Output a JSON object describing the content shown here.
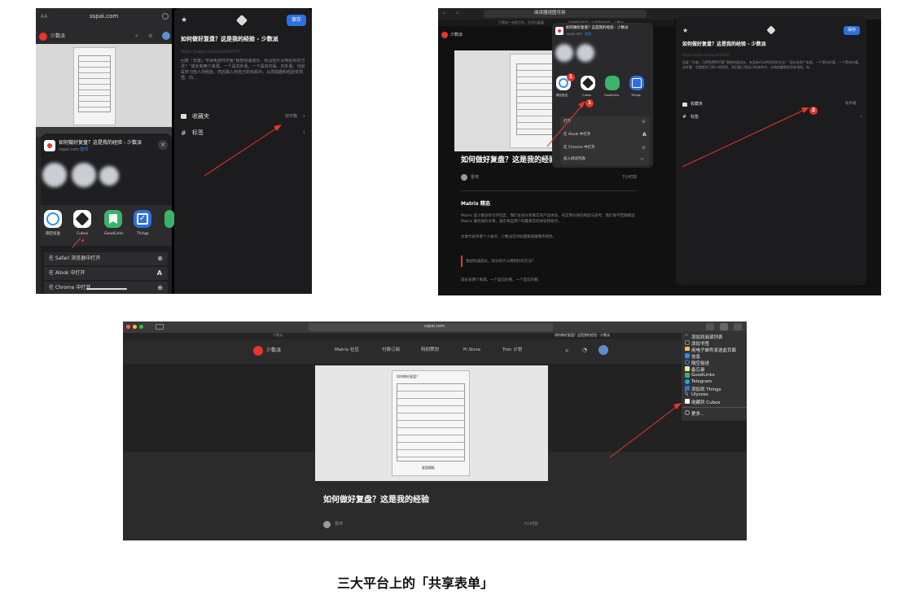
{
  "panel1": {
    "url_size": "AA",
    "url": "sspai.com",
    "site_name": "少数派",
    "share_title": "如何做好复盘？这是我的经验 - 少数派",
    "share_domain": "sspai.com",
    "share_options": "选项",
    "apps": [
      "隔空投送",
      "Cubox",
      "GoodLinks",
      "Things"
    ],
    "actions": [
      "在 Safari 浏览器中打开",
      "在 Alook 中打开",
      "在 Chrome 中打开"
    ],
    "sheet": {
      "save": "保存",
      "title": "如何做好复盘？这是我的经验 - 少数派",
      "url": "https://sspai.com/post/61557",
      "desc": "回复「年度」可得免费PDF版“我想快速成长，有没有什么特别好的方法？”成长有两个来源，一个是向外看，一个是向内看。向外看：也就是学习他人的经验，然后融入到自己的体系中。从周底趣和经验有领悟。向...",
      "folder": "收藏夹",
      "folder_value": "收件箱",
      "tags": "标签"
    }
  },
  "panel2": {
    "address": "阅读器视图可用",
    "tab_left": "只是说一句话工作、生活与复盘",
    "tab_right": "如何做好复盘？这是我的经验 - 少数派",
    "url": "sspai.com",
    "site_name": "少数派",
    "share_title": "如何做好复盘？这是我的经验 - 少数派",
    "share_domain": "sspai.com",
    "share_options": "选项",
    "apps": [
      "隔空投送",
      "Cubox",
      "GoodLinks",
      "Things"
    ],
    "app_badge": "1",
    "actions": [
      "打开",
      "在 Alook 中打开",
      "在 Chrome 中打开",
      "加入阅读列表"
    ],
    "article_title": "如何做好复盘？这是我的经验",
    "author": "曹琦",
    "time": "7小时前",
    "section": "Matrix 精选",
    "body1": "Matrix 是少数派的写作社区，我们主张分享真实的产品体验、有实用价值的经验与思考。我们会不定期挑选 Matrix 最优质的文章，展示来自用户的最真实的体验和观点。",
    "body2": "文章代表作者个人观点，少数派仅对标题和排版略作修改。",
    "quote": "我想快速成长，有没有什么特别好的方法？",
    "body3": "成长有两个来源，一个是向外看，一个是向内看：",
    "sheet": {
      "save": "保存",
      "title": "如何做好复盘？这是我的经验 - 少数派",
      "url": "https://sspai.com/post/61557",
      "desc": "回复「年度」可得免费PDF版“我想快速成长，有没有什么特别好的方法？”成长有两个来源，一个是向外看，一个是向内看。向外看：也就是学习他人的经验，然后融入到自己的体系中。从周底趣和经验有领悟。向...",
      "folder": "收藏夹",
      "folder_value": "收件箱",
      "tags": "标签"
    },
    "callout1": "1",
    "callout2": "2"
  },
  "panel3": {
    "url": "sspai.com",
    "tab_left": "少数派",
    "tab_right": "如何做好复盘？这是我的经验 - 少数派",
    "site_name": "少数派",
    "nav": [
      "Matrix 社区",
      "付费订阅",
      "特别策划",
      "Pi Store",
      "Tron 计划"
    ],
    "article_title": "如何做好复盘？这是我的经验",
    "author": "曹琦",
    "time": "7小时前",
    "menu": [
      "添加到阅读列表",
      "添加书签",
      "用电子邮件发送此页面",
      "信息",
      "隔空投送",
      "备忘录",
      "GoodLinks",
      "Telegram",
      "添加到 Things",
      "Ulysses",
      "收藏到 Cubox",
      "更多..."
    ],
    "doc_title": "如何做好复盘？",
    "doc_footer": "复盘模板"
  },
  "caption": "三大平台上的「共享表单」",
  "colors": {
    "accent": "#e5352c",
    "blue": "#2f6fe0",
    "dark": "#1c1c1e"
  }
}
